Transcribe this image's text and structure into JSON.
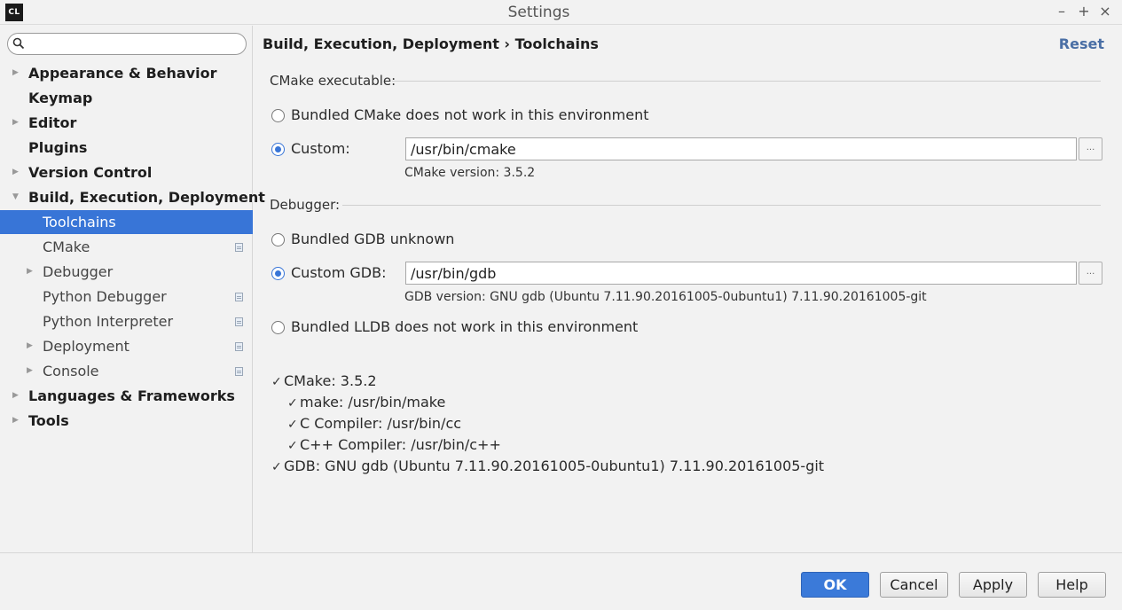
{
  "window": {
    "logo": "CL",
    "title": "Settings",
    "controls": {
      "minimize": "–",
      "maximize": "+",
      "close": "×"
    }
  },
  "sidebar": {
    "search": {
      "value": "",
      "placeholder": ""
    },
    "items": [
      {
        "label": "Appearance & Behavior",
        "level": 0,
        "arrow": "right"
      },
      {
        "label": "Keymap",
        "level": 0,
        "arrow": "none"
      },
      {
        "label": "Editor",
        "level": 0,
        "arrow": "right"
      },
      {
        "label": "Plugins",
        "level": 0,
        "arrow": "none"
      },
      {
        "label": "Version Control",
        "level": 0,
        "arrow": "right"
      },
      {
        "label": "Build, Execution, Deployment",
        "level": 0,
        "arrow": "down"
      },
      {
        "label": "Toolchains",
        "level": 1,
        "arrow": "none",
        "selected": true
      },
      {
        "label": "CMake",
        "level": 1,
        "arrow": "none",
        "project_icon": true
      },
      {
        "label": "Debugger",
        "level": 1,
        "arrow": "right"
      },
      {
        "label": "Python Debugger",
        "level": 1,
        "arrow": "none",
        "project_icon": true
      },
      {
        "label": "Python Interpreter",
        "level": 1,
        "arrow": "none",
        "project_icon": true
      },
      {
        "label": "Deployment",
        "level": 1,
        "arrow": "right",
        "project_icon": true
      },
      {
        "label": "Console",
        "level": 1,
        "arrow": "right",
        "project_icon": true
      },
      {
        "label": "Languages & Frameworks",
        "level": 0,
        "arrow": "right"
      },
      {
        "label": "Tools",
        "level": 0,
        "arrow": "right"
      }
    ]
  },
  "content": {
    "breadcrumb": "Build, Execution, Deployment › Toolchains",
    "reset": "Reset",
    "cmake": {
      "section_title": "CMake executable:",
      "bundled_label": "Bundled CMake does not work in this environment",
      "bundled_selected": false,
      "custom_label": "Custom:",
      "custom_selected": true,
      "path": "/usr/bin/cmake",
      "browse": "...",
      "version": "CMake version: 3.5.2"
    },
    "debugger": {
      "section_title": "Debugger:",
      "bundled_gdb_label": "Bundled GDB unknown",
      "bundled_gdb_selected": false,
      "custom_label": "Custom GDB:",
      "custom_selected": true,
      "path": "/usr/bin/gdb",
      "browse": "...",
      "version": "GDB version: GNU gdb (Ubuntu 7.11.90.20161005-0ubuntu1) 7.11.90.20161005-git",
      "bundled_lldb_label": "Bundled LLDB does not work in this environment",
      "bundled_lldb_selected": false
    },
    "checks": {
      "mark": "✓",
      "cmake": "CMake: 3.5.2",
      "make": "make: /usr/bin/make",
      "c_compiler": "C Compiler: /usr/bin/cc",
      "cpp_compiler": "C++ Compiler: /usr/bin/c++",
      "gdb": "GDB: GNU gdb (Ubuntu 7.11.90.20161005-0ubuntu1) 7.11.90.20161005-git"
    }
  },
  "footer": {
    "ok": "OK",
    "cancel": "Cancel",
    "apply": "Apply",
    "help": "Help"
  },
  "colors": {
    "selection": "#3875d7",
    "primary_button": "#3b7ad9",
    "link": "#4a6fa5"
  }
}
